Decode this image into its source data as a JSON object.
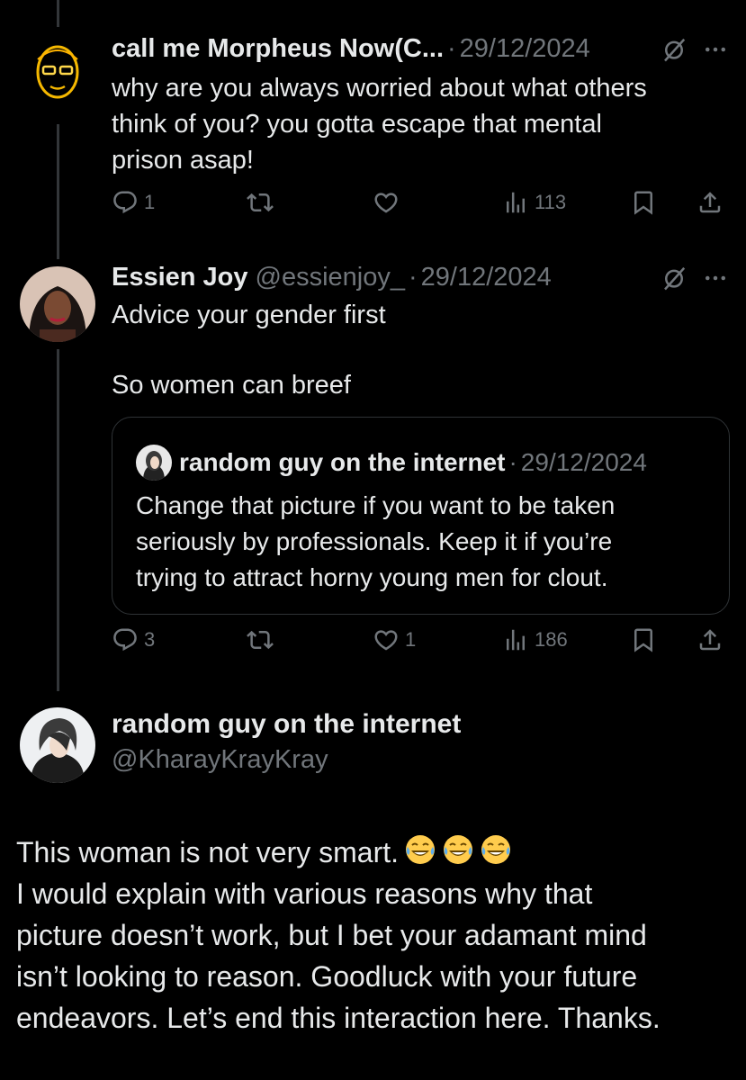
{
  "tweets": [
    {
      "name": "call me Morpheus Now(C...",
      "handle": "",
      "date": "29/12/2024",
      "text_lines": [
        "why are you always worried about what others",
        "think of you? you gotta escape that mental",
        "prison asap!"
      ],
      "replies": "1",
      "retweets": "",
      "likes": "",
      "views": "113"
    },
    {
      "name": "Essien Joy",
      "handle": "@essienjoy_",
      "date": "29/12/2024",
      "text_line1": "Advice your gender first",
      "text_line2": "So women can breef",
      "replies": "3",
      "retweets": "",
      "likes": "1",
      "views": "186",
      "quote": {
        "name": "random guy on the internet",
        "date": "29/12/2024",
        "text_lines": [
          "Change that picture if you want to be taken",
          "seriously by professionals. Keep it if you’re",
          "trying to attract horny young men for clout."
        ]
      }
    }
  ],
  "separator": "·",
  "main_tweet": {
    "name": "random guy on the internet",
    "handle": "@KharayKrayKray",
    "line1": "This woman is not very smart.",
    "emojis": [
      "face-with-tears-of-joy",
      "face-with-tears-of-joy",
      "face-with-tears-of-joy"
    ],
    "lines": [
      "I would explain with various reasons why that",
      "picture doesn’t work, but I bet your adamant mind",
      "isn’t looking to reason. Goodluck with your future",
      "endeavors. Let’s end this interaction here. Thanks."
    ]
  },
  "colors": {
    "background": "#000000",
    "text": "#e7e9ea",
    "muted": "#71767b",
    "border": "#2f3336"
  }
}
